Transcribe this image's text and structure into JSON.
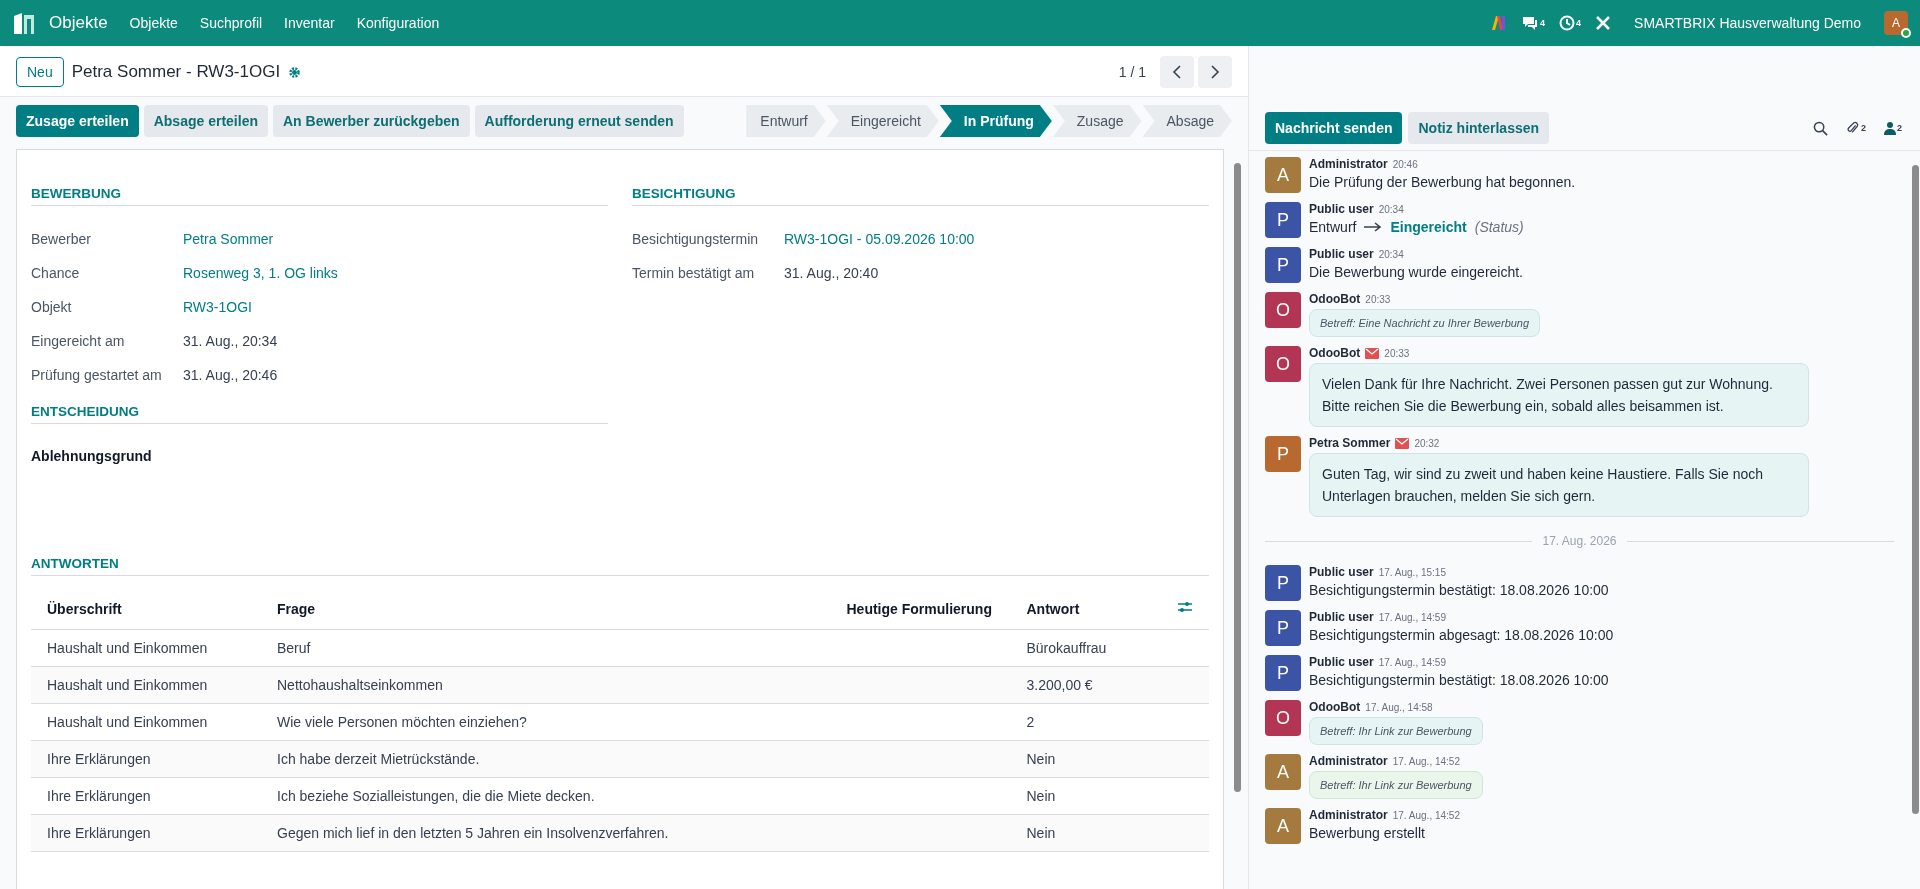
{
  "navbar": {
    "app": "Objekte",
    "menu": [
      "Objekte",
      "Suchprofil",
      "Inventar",
      "Konfiguration"
    ],
    "messages_count": "4",
    "activities_count": "4",
    "company": "SMARTBRIX Hausverwaltung Demo",
    "user_initial": "A"
  },
  "control": {
    "new_button": "Neu",
    "title": "Petra Sommer - RW3-1OGI",
    "pager": "1 / 1"
  },
  "actions": [
    {
      "label": "Zusage erteilen",
      "primary": true
    },
    {
      "label": "Absage erteilen",
      "primary": false
    },
    {
      "label": "An Bewerber zurückgeben",
      "primary": false
    },
    {
      "label": "Aufforderung erneut senden",
      "primary": false
    }
  ],
  "stages": [
    {
      "label": "Entwurf",
      "selected": false
    },
    {
      "label": "Eingereicht",
      "selected": false
    },
    {
      "label": "In Prüfung",
      "selected": true
    },
    {
      "label": "Zusage",
      "selected": false
    },
    {
      "label": "Absage",
      "selected": false
    }
  ],
  "form": {
    "left_groups": [
      {
        "title": "BEWERBUNG",
        "fields": [
          {
            "kind": "inline",
            "label": "Bewerber",
            "value": "Petra Sommer",
            "link": true
          },
          {
            "kind": "inline",
            "label": "Chance",
            "value": "Rosenweg 3, 1. OG links",
            "link": true
          },
          {
            "kind": "inline",
            "label": "Objekt",
            "value": "RW3-1OGI",
            "link": true
          },
          {
            "kind": "inline",
            "label": "Eingereicht am",
            "value": "31. Aug., 20:34",
            "link": false
          },
          {
            "kind": "inline",
            "label": "Prüfung gestartet am",
            "value": "31. Aug., 20:46",
            "link": false
          }
        ]
      },
      {
        "title": "ENTSCHEIDUNG",
        "fields": [
          {
            "kind": "stacked",
            "label": "Ablehnungsgrund"
          }
        ]
      }
    ],
    "right_groups": [
      {
        "title": "BESICHTIGUNG",
        "fields": [
          {
            "kind": "inline",
            "label": "Besichtigungstermin",
            "value": "RW3-1OGI - 05.09.2026 10:00",
            "link": true
          },
          {
            "kind": "inline",
            "label": "Termin bestätigt am",
            "value": "31. Aug., 20:40",
            "link": false
          }
        ]
      }
    ],
    "answers": {
      "title": "ANTWORTEN",
      "columns": [
        "Überschrift",
        "Frage",
        "Heutige Formulierung",
        "Antwort"
      ],
      "rows": [
        [
          "Haushalt und Einkommen",
          "Beruf",
          "",
          "Bürokauffrau"
        ],
        [
          "Haushalt und Einkommen",
          "Nettohaushaltseinkommen",
          "",
          "3.200,00 €"
        ],
        [
          "Haushalt und Einkommen",
          "Wie viele Personen möchten einziehen?",
          "",
          "2"
        ],
        [
          "Ihre Erklärungen",
          "Ich habe derzeit Mietrückstände.",
          "",
          "Nein"
        ],
        [
          "Ihre Erklärungen",
          "Ich beziehe Sozialleistungen, die die Miete decken.",
          "",
          "Nein"
        ],
        [
          "Ihre Erklärungen",
          "Gegen mich lief in den letzten 5 Jahren ein Insolvenzverfahren.",
          "",
          "Nein"
        ]
      ]
    }
  },
  "chatter": {
    "buttons": [
      {
        "label": "Nachricht senden",
        "primary": true
      },
      {
        "label": "Notiz hinterlassen",
        "primary": false
      }
    ],
    "attachments_count": "2",
    "followers_count": "2",
    "messages": [
      {
        "kind": "text",
        "initial": "A",
        "color": "#a57a3e",
        "author": "Administrator",
        "email": false,
        "time": "20:46",
        "body": "Die Prüfung der Bewerbung hat begonnen."
      },
      {
        "kind": "tracking",
        "initial": "P",
        "color": "#3c54a5",
        "author": "Public user",
        "email": false,
        "time": "20:34",
        "old": "Entwurf",
        "new": "Eingereicht",
        "field": "(Status)"
      },
      {
        "kind": "text",
        "initial": "P",
        "color": "#3c54a5",
        "author": "Public user",
        "email": false,
        "time": "20:34",
        "body": "Die Bewerbung wurde eingereicht."
      },
      {
        "kind": "subject",
        "initial": "O",
        "color": "#b23553",
        "author": "OdooBot",
        "email": false,
        "time": "20:33",
        "body": "Betreff: Eine Nachricht zu Ihrer Bewerbung"
      },
      {
        "kind": "message",
        "initial": "O",
        "color": "#b23553",
        "author": "OdooBot",
        "email": true,
        "time": "20:33",
        "body": "Vielen Dank für Ihre Nachricht. Zwei Personen passen gut zur Wohnung. Bitte reichen Sie die Bewerbung ein, sobald alles beisammen ist."
      },
      {
        "kind": "message",
        "initial": "P",
        "color": "#b8692f",
        "author": "Petra Sommer",
        "email": true,
        "time": "20:32",
        "body": "Guten Tag, wir sind zu zweit und haben keine Haustiere. Falls Sie noch Unterlagen brauchen, melden Sie sich gern."
      },
      {
        "kind": "separator",
        "body": "17. Aug. 2026"
      },
      {
        "kind": "text",
        "initial": "P",
        "color": "#3c54a5",
        "author": "Public user",
        "email": false,
        "time": "17. Aug., 15:15",
        "body": "Besichtigungstermin bestätigt: 18.08.2026 10:00"
      },
      {
        "kind": "text",
        "initial": "P",
        "color": "#3c54a5",
        "author": "Public user",
        "email": false,
        "time": "17. Aug., 14:59",
        "body": "Besichtigungstermin abgesagt: 18.08.2026 10:00"
      },
      {
        "kind": "text",
        "initial": "P",
        "color": "#3c54a5",
        "author": "Public user",
        "email": false,
        "time": "17. Aug., 14:59",
        "body": "Besichtigungstermin bestätigt: 18.08.2026 10:00"
      },
      {
        "kind": "subject",
        "initial": "O",
        "color": "#b23553",
        "author": "OdooBot",
        "email": false,
        "time": "17. Aug., 14:58",
        "body": "Betreff: Ihr Link zur Bewerbung"
      },
      {
        "kind": "note_subject",
        "initial": "A",
        "color": "#a57a3e",
        "author": "Administrator",
        "email": false,
        "time": "17. Aug., 14:52",
        "body": "Betreff: Ihr Link zur Bewerbung"
      },
      {
        "kind": "text",
        "initial": "A",
        "color": "#a57a3e",
        "author": "Administrator",
        "email": false,
        "time": "17. Aug., 14:52",
        "body": "Bewerbung erstellt"
      }
    ]
  }
}
